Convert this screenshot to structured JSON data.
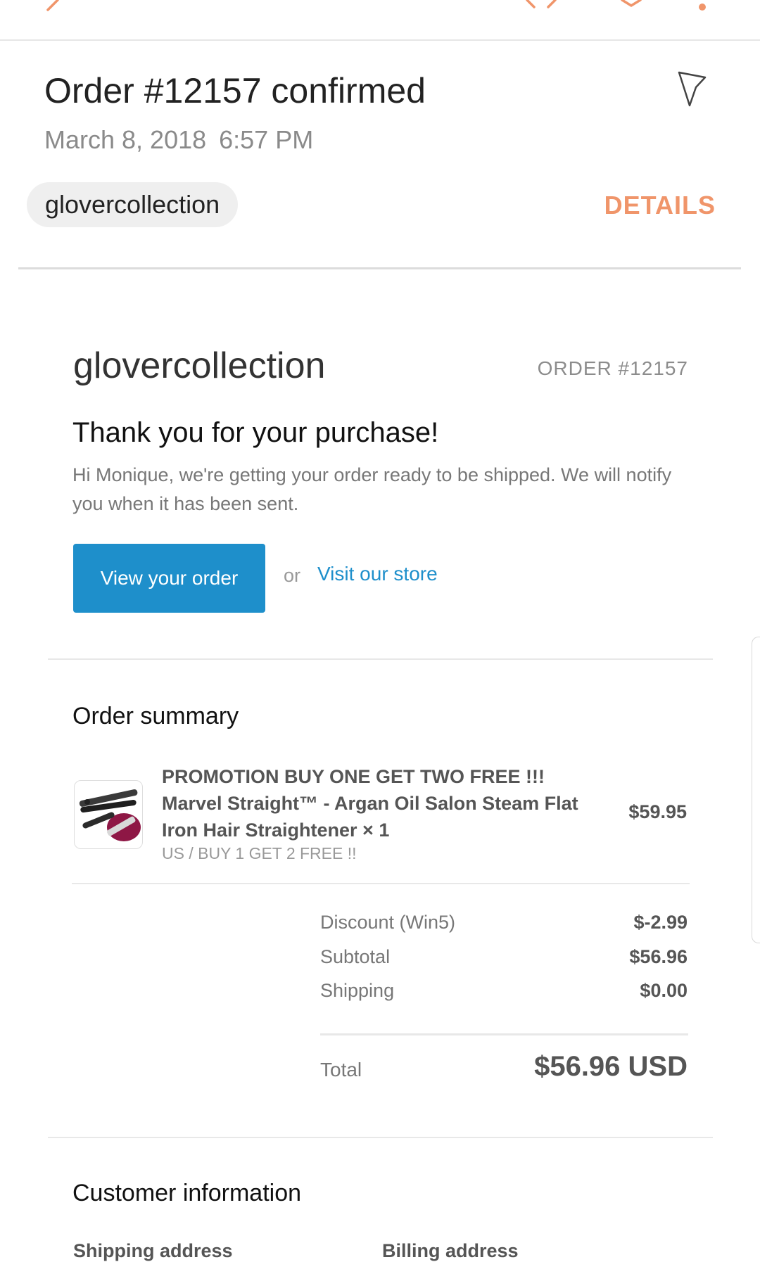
{
  "toolbar": {
    "back_icon": "chevron-left-icon",
    "close_icon": "close-icon",
    "dropdown_icon": "chevron-down-icon",
    "more_icon": "more-vert-icon",
    "accent_color": "#f0956a"
  },
  "header": {
    "subject": "Order #12157 confirmed",
    "date": "March 8, 2018",
    "time": "6:57 PM",
    "flag_icon": "flag-icon",
    "sender": "glovercollection",
    "details_label": "DETAILS"
  },
  "email": {
    "store_name": "glovercollection",
    "order_number": "ORDER #12157",
    "thank_you": "Thank you for your purchase!",
    "message": "Hi Monique, we're getting your order ready to be shipped. We will notify you when it has been sent.",
    "view_order_label": "View your order",
    "or_label": "or",
    "visit_store_label": "Visit our store",
    "button_color": "#1e8fcb"
  },
  "order_summary": {
    "title": "Order summary",
    "item": {
      "title": "PROMOTION BUY ONE GET TWO FREE !!! Marvel Straight™ - Argan Oil Salon Steam Flat Iron Hair Straightener × 1",
      "variant": "US / BUY 1 GET 2 FREE !!",
      "price": "$59.95"
    },
    "lines": [
      {
        "label": "Discount (Win5)",
        "value": "$-2.99"
      },
      {
        "label": "Subtotal",
        "value": "$56.96"
      },
      {
        "label": "Shipping",
        "value": "$0.00"
      }
    ],
    "total_label": "Total",
    "total_value": "$56.96 USD"
  },
  "customer_info": {
    "title": "Customer information",
    "shipping_heading": "Shipping address",
    "billing_heading": "Billing address"
  }
}
